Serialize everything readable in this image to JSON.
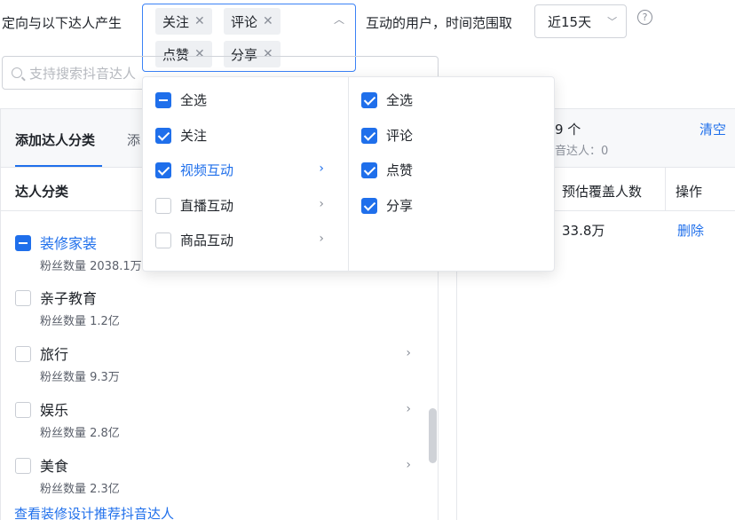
{
  "filter": {
    "prefix": "定向与以下达人产生",
    "tags": [
      "关注",
      "评论",
      "点赞",
      "分享"
    ],
    "middle": "互动的用户，时间范围取",
    "time_value": "近15天",
    "help_icon": "?"
  },
  "search": {
    "placeholder": "支持搜索抖音达人"
  },
  "left_panel": {
    "tab_active": "添加达人分类",
    "tab_2": "添",
    "section_header": "达人分类",
    "categories": [
      {
        "name": "装修家装",
        "fans": "粉丝数量 2038.1万",
        "state": "indeterminate"
      },
      {
        "name": "亲子教育",
        "fans": "粉丝数量 1.2亿",
        "state": "unchecked"
      },
      {
        "name": "旅行",
        "fans": "粉丝数量 9.3万",
        "state": "unchecked"
      },
      {
        "name": "娱乐",
        "fans": "粉丝数量 2.8亿",
        "state": "unchecked"
      },
      {
        "name": "美食",
        "fans": "粉丝数量 2.3亿",
        "state": "unchecked"
      }
    ],
    "bottom_link": "查看装修设计推荐抖音达人"
  },
  "right_panel": {
    "count": "9 个",
    "sub": "音达人：0",
    "clear": "清空",
    "col_coverage": "预估覆盖人数",
    "col_action": "操作",
    "row_coverage": "33.8万",
    "row_action": "删除"
  },
  "dropdown": {
    "left": [
      {
        "label": "全选",
        "state": "indeterminate"
      },
      {
        "label": "关注",
        "state": "checked"
      },
      {
        "label": "视频互动",
        "state": "checked",
        "active": true
      },
      {
        "label": "直播互动",
        "state": "unchecked"
      },
      {
        "label": "商品互动",
        "state": "unchecked"
      }
    ],
    "right": [
      {
        "label": "全选",
        "state": "checked"
      },
      {
        "label": "评论",
        "state": "checked"
      },
      {
        "label": "点赞",
        "state": "checked"
      },
      {
        "label": "分享",
        "state": "checked"
      }
    ]
  },
  "colors": {
    "accent": "#1f6feb",
    "border": "#e5e7eb"
  }
}
